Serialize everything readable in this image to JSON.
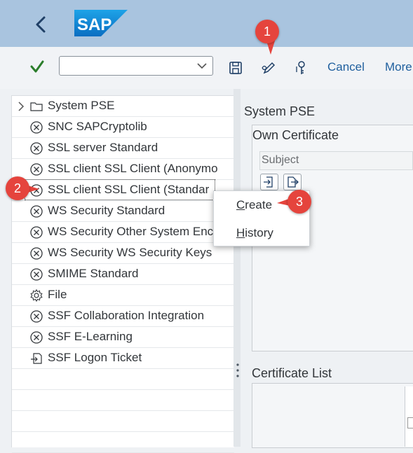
{
  "header": {
    "logo_text": "SAP"
  },
  "toolbar": {
    "combo_value": "",
    "cancel_label": "Cancel",
    "more_label": "More"
  },
  "tree": {
    "items": [
      {
        "label": "System PSE",
        "icon": "folder-icon"
      },
      {
        "label": "SNC SAPCryptolib",
        "icon": "circle-x-icon"
      },
      {
        "label": "SSL server Standard",
        "icon": "circle-x-icon"
      },
      {
        "label": "SSL client SSL Client (Anonymo",
        "icon": "circle-x-icon"
      },
      {
        "label": "SSL client SSL Client (Standar",
        "icon": "circle-x-icon"
      },
      {
        "label": "WS Security Standard",
        "icon": "circle-x-icon"
      },
      {
        "label": "WS Security Other System Enc",
        "icon": "circle-x-icon"
      },
      {
        "label": "WS Security WS Security Keys",
        "icon": "circle-x-icon"
      },
      {
        "label": "SMIME Standard",
        "icon": "circle-x-icon"
      },
      {
        "label": "File",
        "icon": "gear-icon"
      },
      {
        "label": "SSF Collaboration Integration",
        "icon": "circle-x-icon"
      },
      {
        "label": "SSF E-Learning",
        "icon": "circle-x-icon"
      },
      {
        "label": "SSF Logon Ticket",
        "icon": "import-icon"
      }
    ]
  },
  "right": {
    "title": "System PSE",
    "own_certificate": "Own Certificate",
    "subject_header": "Subject",
    "certificate_list": "Certificate List"
  },
  "context_menu": {
    "create_first": "C",
    "create_rest": "reate",
    "history_first": "H",
    "history_rest": "istory"
  },
  "callouts": {
    "one": "1",
    "two": "2",
    "three": "3"
  },
  "colors": {
    "header": "#a9c4df",
    "accent": "#1f5f9e",
    "callout": "#e5443d",
    "check": "#2b7d2b"
  }
}
